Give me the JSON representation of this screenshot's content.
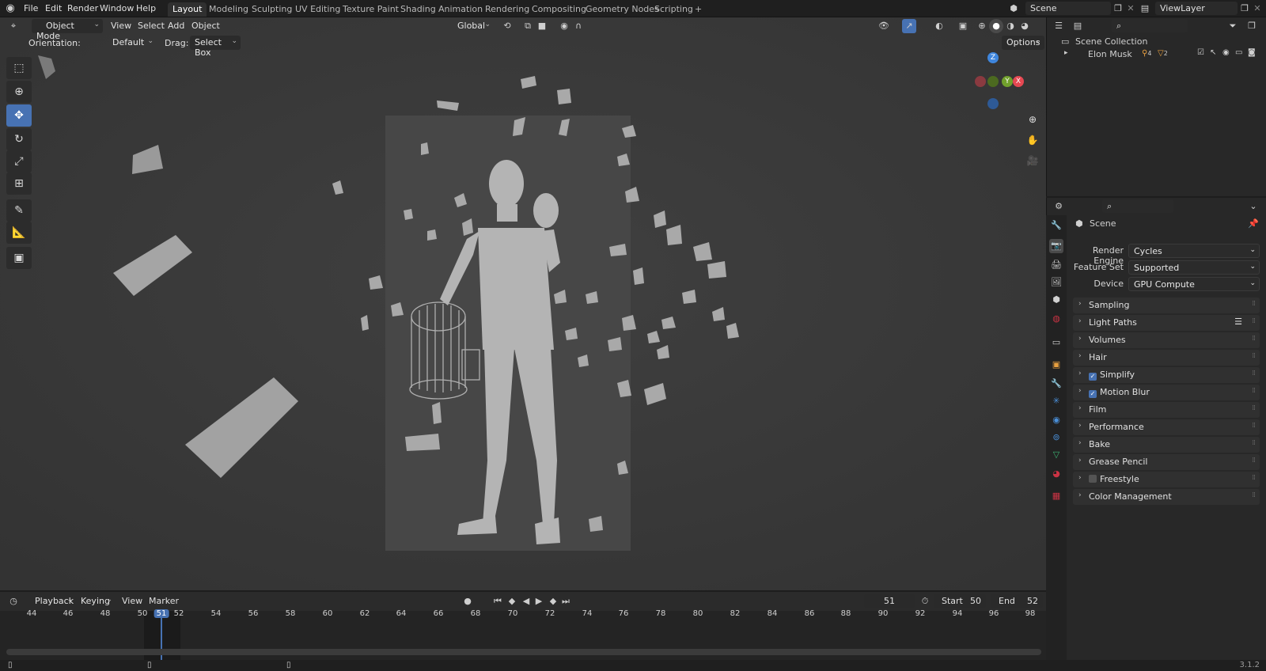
{
  "menubar": {
    "items": [
      "File",
      "Edit",
      "Render",
      "Window",
      "Help"
    ],
    "workspaces": [
      "Layout",
      "Modeling",
      "Sculpting",
      "UV Editing",
      "Texture Paint",
      "Shading",
      "Animation",
      "Rendering",
      "Compositing",
      "Geometry Nodes",
      "Scripting"
    ],
    "active_workspace": "Layout",
    "add_tab": "+",
    "scene": "Scene",
    "view_layer": "ViewLayer"
  },
  "viewport_header": {
    "mode": "Object Mode",
    "menus": [
      "View",
      "Select",
      "Add",
      "Object"
    ],
    "orientation_transform": "Global",
    "options": "Options"
  },
  "tool_settings": {
    "orientation_label": "Orientation:",
    "orientation_value": "Default",
    "drag_label": "Drag:",
    "drag_value": "Select Box"
  },
  "gizmo": {
    "z": "Z",
    "y": "Y",
    "x": "X"
  },
  "outliner": {
    "collection": "Scene Collection",
    "object": "Elon Musk",
    "badge_count": "4",
    "badge_count2": "2"
  },
  "properties": {
    "title": "Scene",
    "render_engine_label": "Render Engine",
    "render_engine": "Cycles",
    "feature_set_label": "Feature Set",
    "feature_set": "Supported",
    "device_label": "Device",
    "device": "GPU Compute",
    "panels": [
      "Sampling",
      "Light Paths",
      "Volumes",
      "Hair",
      "Simplify",
      "Motion Blur",
      "Film",
      "Performance",
      "Bake",
      "Grease Pencil",
      "Freestyle",
      "Color Management"
    ]
  },
  "timeline": {
    "menus": [
      "Playback",
      "Keying",
      "View",
      "Marker"
    ],
    "current_frame": "51",
    "start_label": "Start",
    "start": "50",
    "end_label": "End",
    "end": "52",
    "ticks": [
      "44",
      "46",
      "48",
      "50",
      "51",
      "52",
      "54",
      "56",
      "58",
      "60",
      "62",
      "64",
      "66",
      "68",
      "70",
      "72",
      "74",
      "76",
      "78",
      "80",
      "82",
      "84",
      "86",
      "88",
      "90",
      "92",
      "94",
      "96",
      "98"
    ]
  },
  "status": {
    "version": "3.1.2"
  },
  "colors": {
    "accent": "#4772b3",
    "gizmo_x": "#e64852",
    "gizmo_y": "#71a02c",
    "gizmo_z": "#3f86dd"
  },
  "icons": [
    "blender-logo-icon",
    "select-box-icon",
    "cursor-icon",
    "move-icon",
    "rotate-icon",
    "scale-icon",
    "transform-icon",
    "annotate-icon",
    "measure-icon",
    "add-cube-icon",
    "zoom-icon",
    "hand-icon",
    "camera-icon"
  ]
}
